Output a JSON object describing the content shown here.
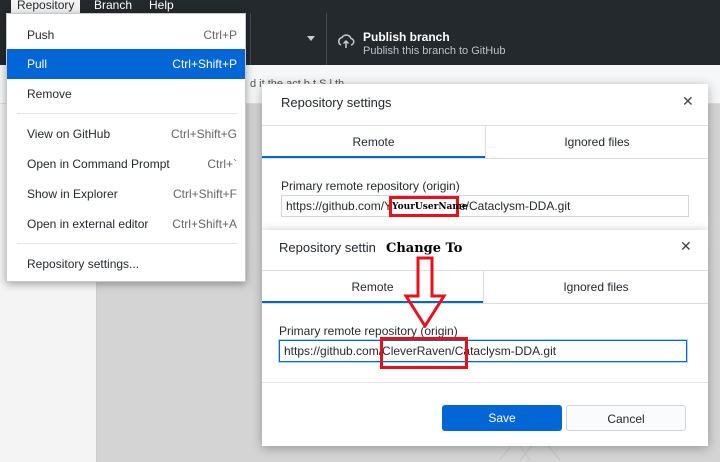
{
  "menubar": {
    "items": [
      "Repository",
      "Branch",
      "Help"
    ]
  },
  "toolbar": {
    "publish_title": "Publish branch",
    "publish_subtitle": "Publish this branch to GitHub"
  },
  "subbar": {
    "text": "d it the act b t    S  l  th"
  },
  "menu": {
    "items": [
      {
        "label": "Push",
        "shortcut": "Ctrl+P"
      },
      {
        "label": "Pull",
        "shortcut": "Ctrl+Shift+P"
      },
      {
        "label": "Remove",
        "shortcut": ""
      },
      {
        "label": "View on GitHub",
        "shortcut": "Ctrl+Shift+G"
      },
      {
        "label": "Open in Command Prompt",
        "shortcut": "Ctrl+`"
      },
      {
        "label": "Show in Explorer",
        "shortcut": "Ctrl+Shift+F"
      },
      {
        "label": "Open in external editor",
        "shortcut": "Ctrl+Shift+A"
      },
      {
        "label": "Repository settings...",
        "shortcut": ""
      }
    ]
  },
  "dialog1": {
    "title": "Repository settings",
    "tabs": [
      "Remote",
      "Ignored files"
    ],
    "field_label": "Primary remote repository (origin)",
    "field_value": "https://github.com/YourUserName/Cataclysm-DDA.git"
  },
  "dialog2": {
    "title": "Repository settings",
    "tabs": [
      "Remote",
      "Ignored files"
    ],
    "field_label": "Primary remote repository (origin)",
    "field_value": "https://github.com/CleverRaven/Cataclysm-DDA.git",
    "save_label": "Save",
    "cancel_label": "Cancel"
  },
  "annotations": {
    "placeholder_text": "YourUserName",
    "change_to": "Change To",
    "color": "#e8101a"
  },
  "colors": {
    "accent": "#0366d6",
    "toolbar": "#24292e"
  }
}
